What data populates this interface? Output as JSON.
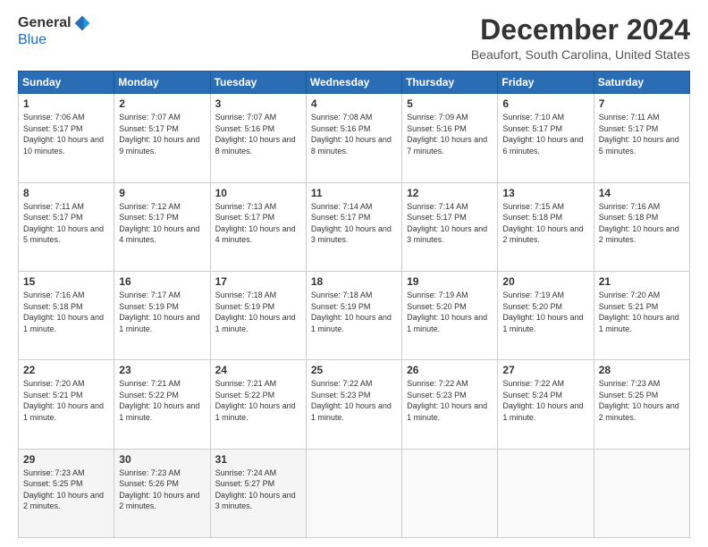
{
  "app": {
    "name": "GeneralBlue",
    "name_general": "General",
    "name_blue": "Blue"
  },
  "header": {
    "month_year": "December 2024",
    "location": "Beaufort, South Carolina, United States"
  },
  "weekdays": [
    "Sunday",
    "Monday",
    "Tuesday",
    "Wednesday",
    "Thursday",
    "Friday",
    "Saturday"
  ],
  "weeks": [
    [
      {
        "day": "1",
        "sunrise": "7:06 AM",
        "sunset": "5:17 PM",
        "daylight": "10 hours and 10 minutes."
      },
      {
        "day": "2",
        "sunrise": "7:07 AM",
        "sunset": "5:17 PM",
        "daylight": "10 hours and 9 minutes."
      },
      {
        "day": "3",
        "sunrise": "7:07 AM",
        "sunset": "5:16 PM",
        "daylight": "10 hours and 8 minutes."
      },
      {
        "day": "4",
        "sunrise": "7:08 AM",
        "sunset": "5:16 PM",
        "daylight": "10 hours and 8 minutes."
      },
      {
        "day": "5",
        "sunrise": "7:09 AM",
        "sunset": "5:16 PM",
        "daylight": "10 hours and 7 minutes."
      },
      {
        "day": "6",
        "sunrise": "7:10 AM",
        "sunset": "5:17 PM",
        "daylight": "10 hours and 6 minutes."
      },
      {
        "day": "7",
        "sunrise": "7:11 AM",
        "sunset": "5:17 PM",
        "daylight": "10 hours and 5 minutes."
      }
    ],
    [
      {
        "day": "8",
        "sunrise": "7:11 AM",
        "sunset": "5:17 PM",
        "daylight": "10 hours and 5 minutes."
      },
      {
        "day": "9",
        "sunrise": "7:12 AM",
        "sunset": "5:17 PM",
        "daylight": "10 hours and 4 minutes."
      },
      {
        "day": "10",
        "sunrise": "7:13 AM",
        "sunset": "5:17 PM",
        "daylight": "10 hours and 4 minutes."
      },
      {
        "day": "11",
        "sunrise": "7:14 AM",
        "sunset": "5:17 PM",
        "daylight": "10 hours and 3 minutes."
      },
      {
        "day": "12",
        "sunrise": "7:14 AM",
        "sunset": "5:17 PM",
        "daylight": "10 hours and 3 minutes."
      },
      {
        "day": "13",
        "sunrise": "7:15 AM",
        "sunset": "5:18 PM",
        "daylight": "10 hours and 2 minutes."
      },
      {
        "day": "14",
        "sunrise": "7:16 AM",
        "sunset": "5:18 PM",
        "daylight": "10 hours and 2 minutes."
      }
    ],
    [
      {
        "day": "15",
        "sunrise": "7:16 AM",
        "sunset": "5:18 PM",
        "daylight": "10 hours and 1 minute."
      },
      {
        "day": "16",
        "sunrise": "7:17 AM",
        "sunset": "5:19 PM",
        "daylight": "10 hours and 1 minute."
      },
      {
        "day": "17",
        "sunrise": "7:18 AM",
        "sunset": "5:19 PM",
        "daylight": "10 hours and 1 minute."
      },
      {
        "day": "18",
        "sunrise": "7:18 AM",
        "sunset": "5:19 PM",
        "daylight": "10 hours and 1 minute."
      },
      {
        "day": "19",
        "sunrise": "7:19 AM",
        "sunset": "5:20 PM",
        "daylight": "10 hours and 1 minute."
      },
      {
        "day": "20",
        "sunrise": "7:19 AM",
        "sunset": "5:20 PM",
        "daylight": "10 hours and 1 minute."
      },
      {
        "day": "21",
        "sunrise": "7:20 AM",
        "sunset": "5:21 PM",
        "daylight": "10 hours and 1 minute."
      }
    ],
    [
      {
        "day": "22",
        "sunrise": "7:20 AM",
        "sunset": "5:21 PM",
        "daylight": "10 hours and 1 minute."
      },
      {
        "day": "23",
        "sunrise": "7:21 AM",
        "sunset": "5:22 PM",
        "daylight": "10 hours and 1 minute."
      },
      {
        "day": "24",
        "sunrise": "7:21 AM",
        "sunset": "5:22 PM",
        "daylight": "10 hours and 1 minute."
      },
      {
        "day": "25",
        "sunrise": "7:22 AM",
        "sunset": "5:23 PM",
        "daylight": "10 hours and 1 minute."
      },
      {
        "day": "26",
        "sunrise": "7:22 AM",
        "sunset": "5:23 PM",
        "daylight": "10 hours and 1 minute."
      },
      {
        "day": "27",
        "sunrise": "7:22 AM",
        "sunset": "5:24 PM",
        "daylight": "10 hours and 1 minute."
      },
      {
        "day": "28",
        "sunrise": "7:23 AM",
        "sunset": "5:25 PM",
        "daylight": "10 hours and 2 minutes."
      }
    ],
    [
      {
        "day": "29",
        "sunrise": "7:23 AM",
        "sunset": "5:25 PM",
        "daylight": "10 hours and 2 minutes."
      },
      {
        "day": "30",
        "sunrise": "7:23 AM",
        "sunset": "5:26 PM",
        "daylight": "10 hours and 2 minutes."
      },
      {
        "day": "31",
        "sunrise": "7:24 AM",
        "sunset": "5:27 PM",
        "daylight": "10 hours and 3 minutes."
      },
      null,
      null,
      null,
      null
    ]
  ]
}
